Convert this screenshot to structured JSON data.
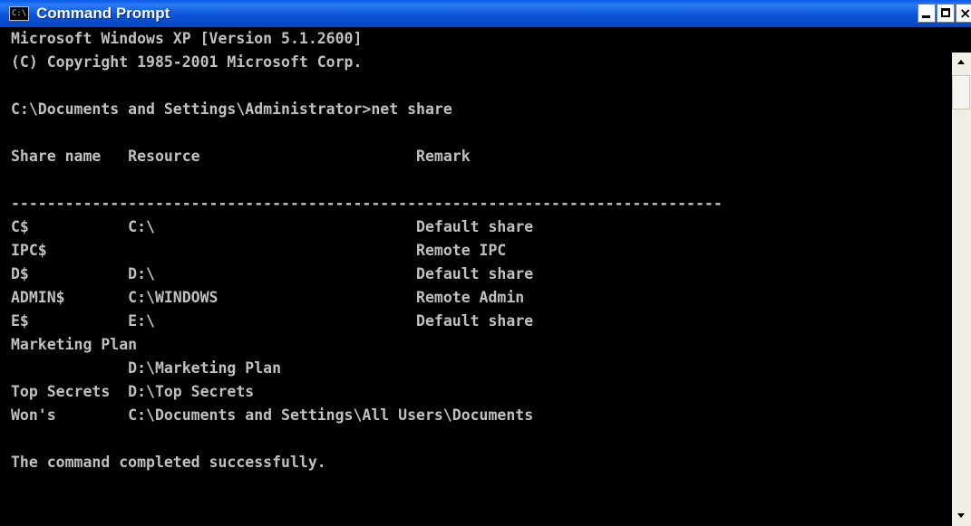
{
  "window": {
    "title": "Command Prompt",
    "icon_label": "C:\\",
    "minimize_glyph": "",
    "maximize_glyph": "",
    "close_glyph": "×"
  },
  "console": {
    "lines": [
      "Microsoft Windows XP [Version 5.1.2600]",
      "(C) Copyright 1985-2001 Microsoft Corp.",
      "",
      "C:\\Documents and Settings\\Administrator>net share",
      "",
      "Share name   Resource                        Remark",
      "",
      "-------------------------------------------------------------------------------",
      "C$           C:\\                             Default share",
      "IPC$                                         Remote IPC",
      "D$           D:\\                             Default share",
      "ADMIN$       C:\\WINDOWS                      Remote Admin",
      "E$           E:\\                             Default share",
      "Marketing Plan",
      "             D:\\Marketing Plan",
      "Top Secrets  D:\\Top Secrets",
      "Won's        C:\\Documents and Settings\\All Users\\Documents",
      "",
      "The command completed successfully."
    ]
  },
  "colors": {
    "console_bg": "#000000",
    "console_text": "#c0c0c0",
    "titlebar": "#0b55d8"
  }
}
